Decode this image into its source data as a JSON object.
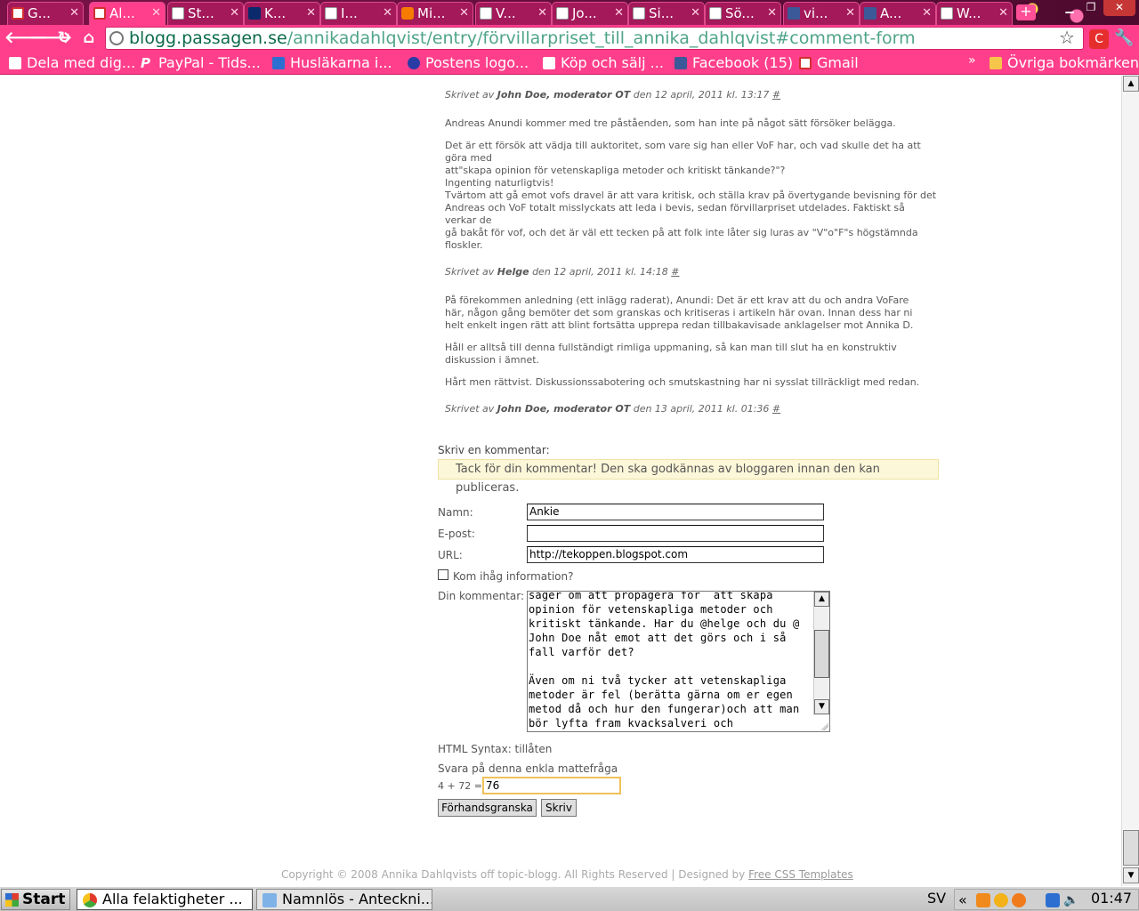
{
  "browser": {
    "tabs": [
      {
        "label": "G...",
        "icon": "gmail-icon",
        "active": false
      },
      {
        "label": "Al...",
        "icon": "blog-icon",
        "active": true
      },
      {
        "label": "St...",
        "icon": "page-icon",
        "active": false
      },
      {
        "label": "K...",
        "icon": "lu-icon",
        "active": false
      },
      {
        "label": "I...",
        "icon": "page-icon",
        "active": false
      },
      {
        "label": "Mi...",
        "icon": "blogger-icon",
        "active": false
      },
      {
        "label": "V...",
        "icon": "page-icon",
        "active": false
      },
      {
        "label": "Jo...",
        "icon": "page-icon",
        "active": false
      },
      {
        "label": "Si...",
        "icon": "page-icon",
        "active": false
      },
      {
        "label": "Sö...",
        "icon": "page-icon",
        "active": false
      },
      {
        "label": "vi...",
        "icon": "facebook-icon",
        "active": false
      },
      {
        "label": "A...",
        "icon": "facebook-icon",
        "active": false
      },
      {
        "label": "W...",
        "icon": "page-icon",
        "active": false
      }
    ],
    "new_tab_label": "+",
    "url_domain": "blogg.passagen.se",
    "url_path": "/annikadahlqvist/entry/förvillarpriset_till_annika_dahlqvist#comment-form",
    "bookmarks": [
      {
        "label": "Dela med dig...",
        "icon": "page-icon"
      },
      {
        "label": "PayPal - Tids...",
        "icon": "paypal-icon"
      },
      {
        "label": "Husläkarna i...",
        "icon": "husl-icon"
      },
      {
        "label": "Postens logo...",
        "icon": "posten-icon"
      },
      {
        "label": "Köp och sälj ...",
        "icon": "page-icon"
      },
      {
        "label": "Facebook (15)",
        "icon": "facebook-icon"
      },
      {
        "label": "Gmail",
        "icon": "gmail-icon"
      }
    ],
    "bookmarks_more": "»",
    "other_bookmarks": "Övriga bokmärken",
    "theme_color": "#ff3f8b"
  },
  "comments": {
    "top_signed": {
      "prefix": "Skrivet av",
      "author": "John Doe, moderator OT",
      "date": "den 12 april, 2011 kl. 13:17",
      "anchor": "#"
    },
    "c1_p1": "Andreas Anundi kommer med tre påståenden, som han inte på något sätt försöker belägga.",
    "c1_p2": "Det är ett försök att vädja till auktoritet, som vare sig han eller VoF har, och vad skulle det ha att\ngöra med\natt\"skapa opinion för vetenskapliga metoder och kritiskt tänkande?\"?\nIngenting naturligtvis!\nTvärtom att gå emot vofs dravel är att vara kritisk, och ställa krav på övertygande bevisning för det\nAndreas och VoF totalt misslyckats att leda i bevis, sedan förvillarpriset utdelades. Faktiskt så\nverkar de\ngå bakåt för vof, och det är väl ett tecken på att folk inte låter sig luras av \"V\"o\"F\"s högstämnda\nfloskler.",
    "c1_signed": {
      "prefix": "Skrivet av",
      "author": "Helge",
      "date": "den 12 april, 2011 kl. 14:18",
      "anchor": "#"
    },
    "c2_p1": "På förekommen anledning (ett inlägg raderat), Anundi: Det är ett krav att du och andra VoFare\nhär, någon gång bemöter det som granskas och kritiseras i artikeln här ovan. Innan dess har ni\nhelt enkelt ingen rätt att blint fortsätta upprepa redan tillbakavisade anklagelser mot Annika D.",
    "c2_p2": "Håll er alltså till denna fullständigt rimliga uppmaning, så kan man till slut ha en konstruktiv\ndiskussion i ämnet.",
    "c2_p3": "Hårt men rättvist. Diskussionssabotering och smutskastning har ni sysslat tillräckligt med redan.",
    "c2_signed": {
      "prefix": "Skrivet av",
      "author": "John Doe, moderator OT",
      "date": "den 13 april, 2011 kl. 01:36",
      "anchor": "#"
    }
  },
  "form": {
    "title": "Skriv en kommentar:",
    "notice": "Tack för din kommentar! Den ska godkännas av bloggaren innan den kan publiceras.",
    "name_label": "Namn:",
    "name_value": "Ankie",
    "email_label": "E-post:",
    "email_value": "",
    "url_label": "URL:",
    "url_value": "http://tekoppen.blogspot.com",
    "remember_label": "Kom ihåg information?",
    "remember_checked": false,
    "comment_label": "Din kommentar:",
    "comment_text": "säger om att propagera för  att skapa opinion för vetenskapliga metoder och kritiskt tänkande. Har du @helge och du @ John Doe nåt emot att det görs och i så fall varför det?\n\nÄven om ni två tycker att vetenskapliga metoder är fel (berätta gärna om er egen metod då och hur den fungerar)och att man bör lyfta fram kvacksalveri och",
    "html_syntax": "HTML Syntax: tillåten",
    "math_question": "Svara på denna enkla mattefråga",
    "math_equation": "4 + 72 =",
    "math_answer": "76",
    "preview_button": "Förhandsgranska",
    "submit_button": "Skriv"
  },
  "footer": {
    "text": "Copyright © 2008 Annika Dahlqvists off topic-blogg. All Rights Reserved | Designed by",
    "link": "Free CSS Templates"
  },
  "taskbar": {
    "start": "Start",
    "tasks": [
      {
        "label": "Alla felaktigheter ...",
        "icon": "chrome-icon"
      },
      {
        "label": "Namnlös - Anteckni...",
        "icon": "notepad-icon"
      }
    ],
    "language": "SV",
    "tray_chevron": "«",
    "clock": "01:47"
  }
}
